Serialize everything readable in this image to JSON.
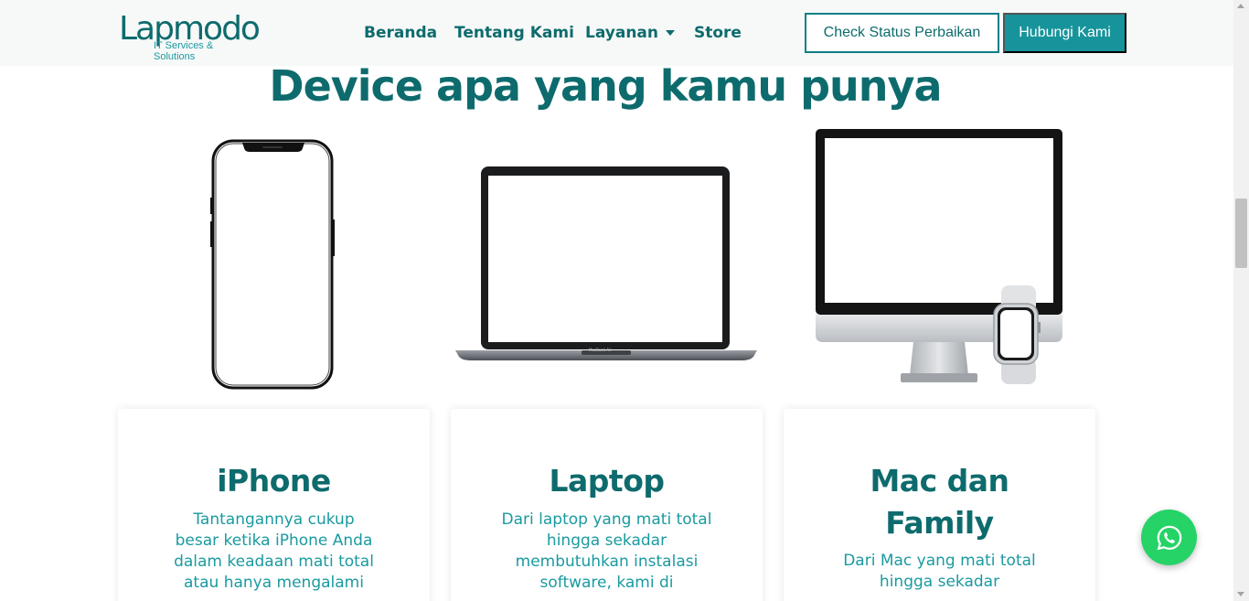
{
  "navbar": {
    "logo_text": "Lapmodo",
    "logo_tagline": "IT Services & Solutions",
    "links": [
      {
        "label": "Beranda"
      },
      {
        "label": "Tentang Kami"
      },
      {
        "label": "Layanan"
      },
      {
        "label": "Store"
      }
    ],
    "check_status_label": "Check Status Perbaikan",
    "contact_label": "Hubungi Kami"
  },
  "section": {
    "title": "Device apa yang kamu punya"
  },
  "devices": [
    {
      "icon": "iphone-image",
      "title": "iPhone",
      "text_lines": [
        "Tantangannya cukup",
        "besar ketika iPhone Anda",
        "dalam keadaan mati total",
        "atau hanya mengalami"
      ]
    },
    {
      "icon": "macbook-image",
      "screen_label": "MacBook Air",
      "title": "Laptop",
      "text_lines": [
        "Dari laptop yang mati total",
        "hingga sekadar",
        "membutuhkan instalasi",
        "software, kami di"
      ]
    },
    {
      "icon": "imac-watch-image",
      "title_lines": [
        "Mac dan",
        "Family"
      ],
      "text_lines": [
        "Dari Mac yang mati total",
        "hingga sekadar"
      ]
    }
  ],
  "whatsapp": {
    "icon": "whatsapp-icon"
  },
  "colors": {
    "brand_dark": "#0e6b6d",
    "brand_accent": "#17949b",
    "text_teal": "#1a9aa0",
    "whatsapp_green": "#25d366",
    "navbar_bg": "#f7f8f8"
  }
}
